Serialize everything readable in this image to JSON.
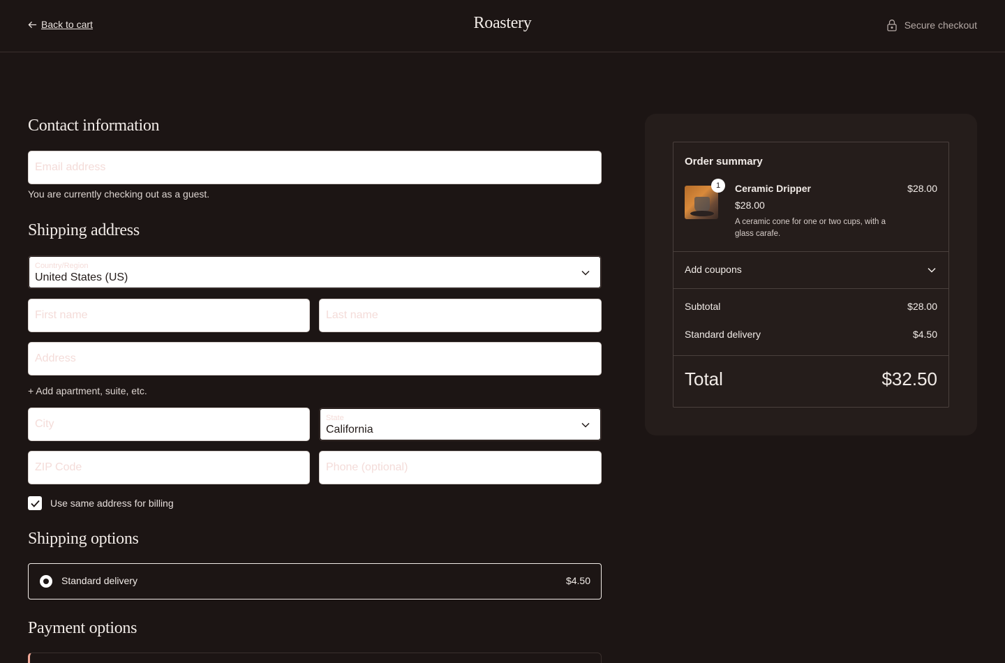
{
  "header": {
    "back_label": "Back to cart",
    "brand": "Roastery",
    "secure_label": "Secure checkout"
  },
  "contact": {
    "title": "Contact information",
    "email_placeholder": "Email address",
    "guest_note": "You are currently checking out as a guest."
  },
  "shipping_address": {
    "title": "Shipping address",
    "country_label": "Country/Region",
    "country_value": "United States (US)",
    "first_name_placeholder": "First name",
    "last_name_placeholder": "Last name",
    "address_placeholder": "Address",
    "add_apartment": "+ Add apartment, suite, etc.",
    "city_placeholder": "City",
    "state_label": "State",
    "state_value": "California",
    "zip_placeholder": "ZIP Code",
    "phone_placeholder": "Phone (optional)",
    "billing_same_label": "Use same address for billing",
    "billing_same_checked": true
  },
  "shipping_options": {
    "title": "Shipping options",
    "selected_label": "Standard delivery",
    "selected_price": "$4.50"
  },
  "payment": {
    "title": "Payment options"
  },
  "summary": {
    "title": "Order summary",
    "item": {
      "quantity": "1",
      "name": "Ceramic Dripper",
      "unit_price": "$28.00",
      "description": "A ceramic cone for one or two cups, with a glass carafe.",
      "line_total": "$28.00"
    },
    "coupons_label": "Add coupons",
    "subtotal_label": "Subtotal",
    "subtotal_value": "$28.00",
    "delivery_label": "Standard delivery",
    "delivery_value": "$4.50",
    "total_label": "Total",
    "total_value": "$32.50"
  }
}
